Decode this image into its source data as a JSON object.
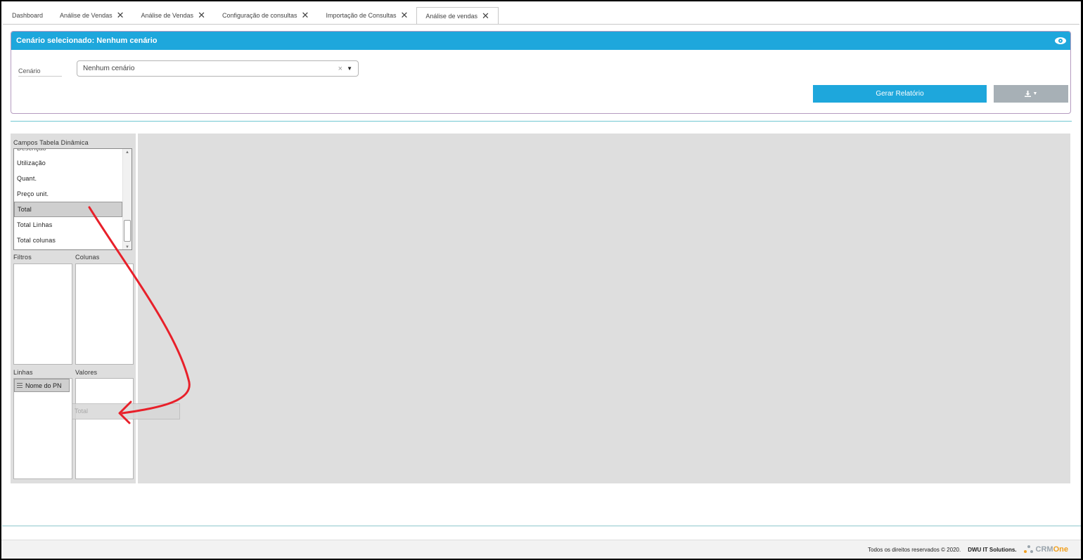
{
  "tabs": [
    {
      "label": "Dashboard",
      "closable": false
    },
    {
      "label": "Análise de Vendas",
      "closable": true
    },
    {
      "label": "Análise de Vendas",
      "closable": true
    },
    {
      "label": "Configuração de consultas",
      "closable": true
    },
    {
      "label": "Importação de Consultas",
      "closable": true
    },
    {
      "label": "Análise de vendas",
      "closable": true,
      "active": true
    }
  ],
  "scenario_panel": {
    "header": "Cenário selecionado: Nenhum cenário",
    "label": "Cenário",
    "select_value": "Nenhum cenário",
    "clear_symbol": "×",
    "generate_button": "Gerar Relatório",
    "download_icon": "download-icon"
  },
  "pivot": {
    "fields_title": "Campos Tabela Dinâmica",
    "fields": [
      "Descrição",
      "Utilização",
      "Quant.",
      "Preço unit.",
      "Total",
      "Total Linhas",
      "Total colunas"
    ],
    "selected_field": "Total",
    "zones": {
      "filters": "Filtros",
      "columns": "Colunas",
      "rows": "Linhas",
      "values": "Valores"
    },
    "rows_chip": "Nome do PN",
    "dragging_item": "Total"
  },
  "footer": {
    "rights": "Todos os direitos reservados © 2020.",
    "company": "DWU IT Solutions.",
    "logo_text_a": "CRM",
    "logo_text_b": "One"
  },
  "colors": {
    "accent": "#1ea7dc",
    "annotation_arrow": "#e8202a"
  }
}
